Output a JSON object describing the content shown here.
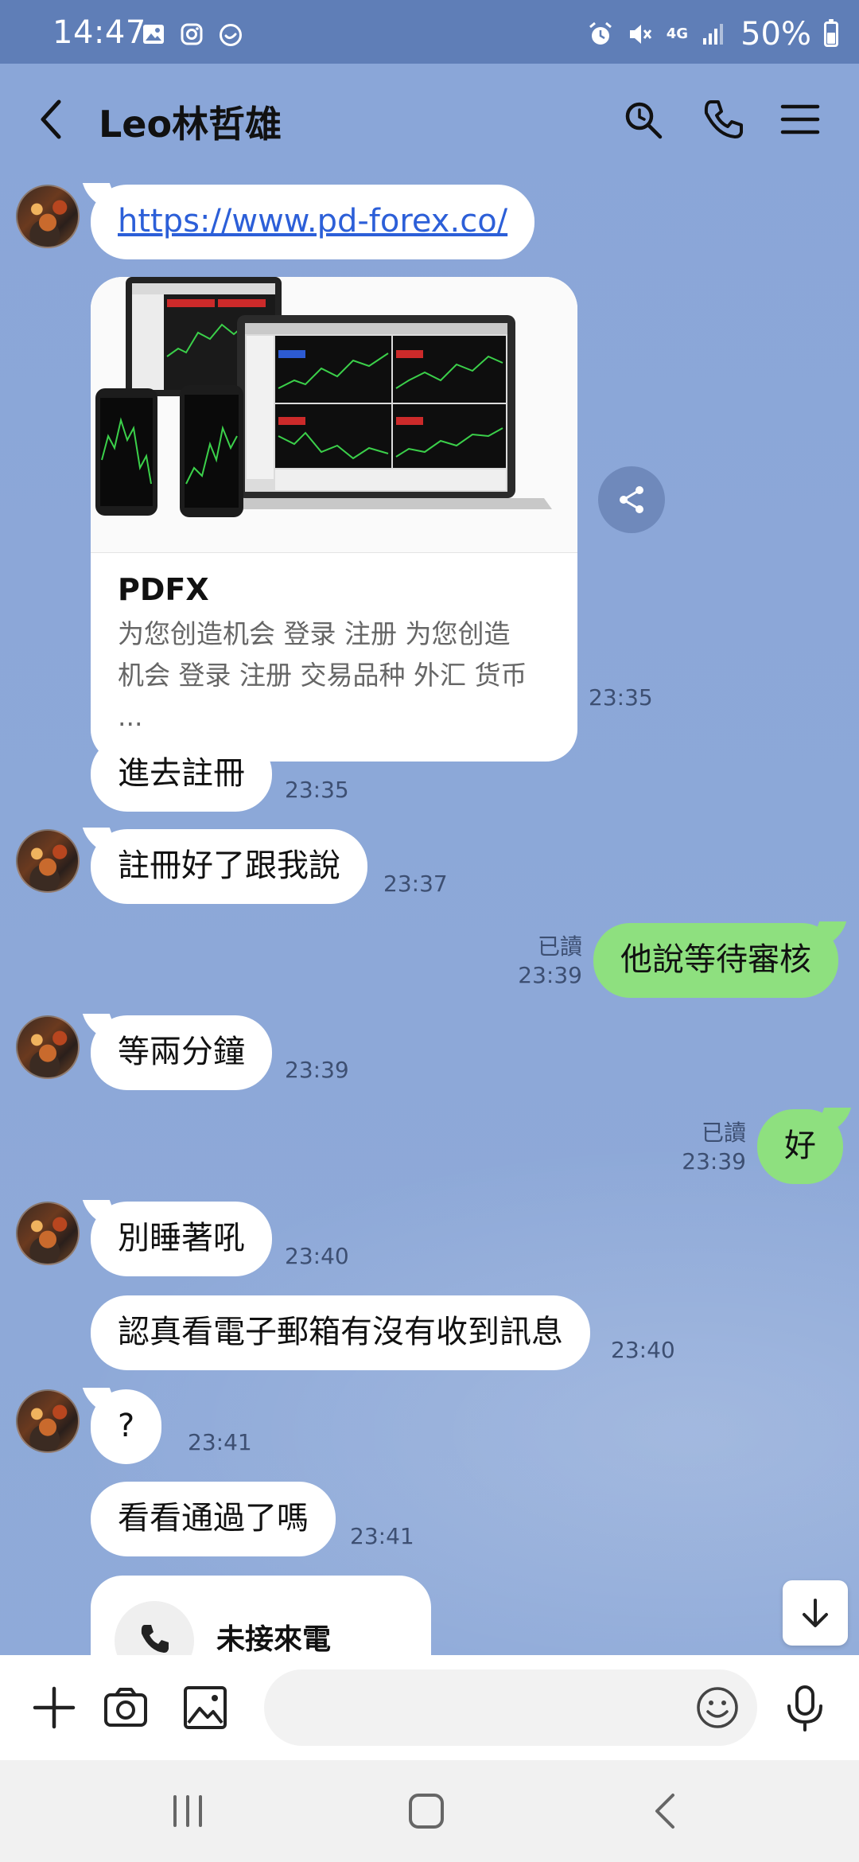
{
  "status_bar": {
    "time": "14:47",
    "battery": "50%",
    "network": "4G"
  },
  "header": {
    "title": "Leo林哲雄"
  },
  "messages": {
    "link": {
      "url": "https://www.pd-forex.co/"
    },
    "card": {
      "title": "PDFX",
      "description_line1": "为您创造机会 登录 注册 为您创造",
      "description_line2": "机会 登录 注册 交易品种 外汇 货币 ...",
      "time": "23:35"
    },
    "m1": {
      "text": "進去註冊",
      "time": "23:35"
    },
    "m2": {
      "text": "註冊好了跟我說",
      "time": "23:37"
    },
    "m3": {
      "text": "他說等待審核",
      "read": "已讀",
      "time": "23:39"
    },
    "m4": {
      "text": "等兩分鐘",
      "time": "23:39"
    },
    "m5": {
      "text": "好",
      "read": "已讀",
      "time": "23:39"
    },
    "m6": {
      "text": "別睡著吼",
      "time": "23:40"
    },
    "m7": {
      "text": "認真看電子郵箱有沒有收到訊息",
      "time": "23:40"
    },
    "m8": {
      "text": "?",
      "time": "23:41"
    },
    "m9": {
      "text": "看看通過了嗎",
      "time": "23:41"
    },
    "missed_call": {
      "text": "未接來電"
    }
  },
  "input": {
    "placeholder": ""
  }
}
